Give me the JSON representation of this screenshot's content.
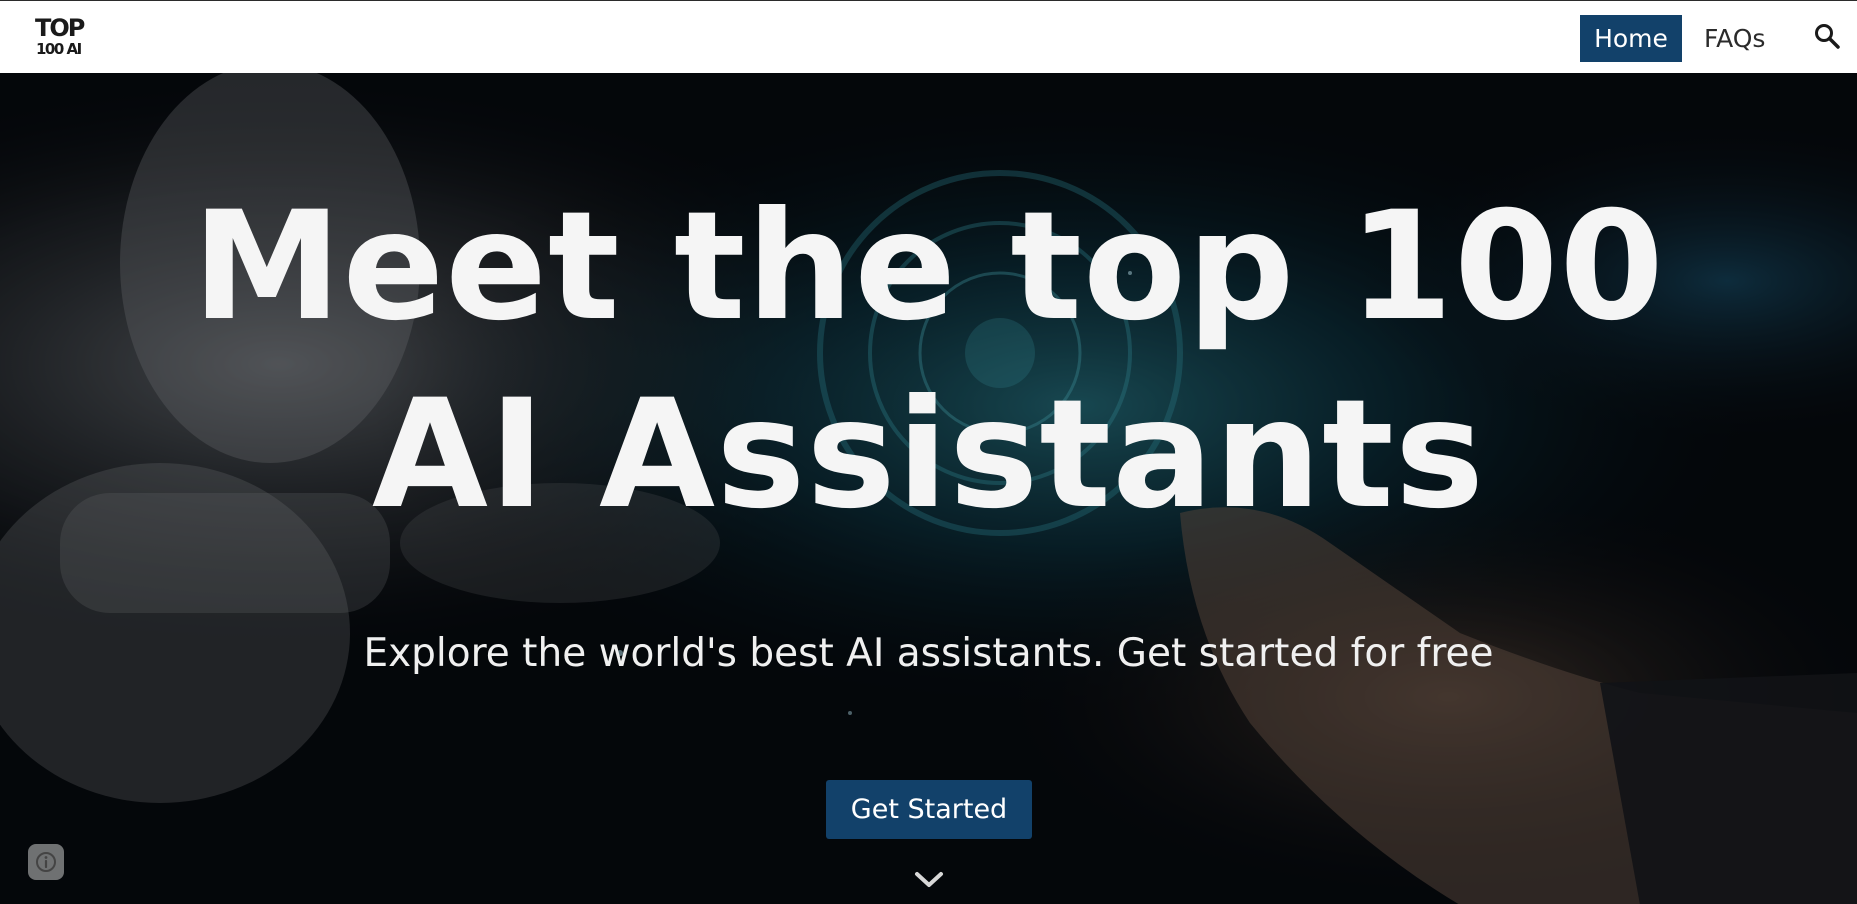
{
  "header": {
    "logo_line1": "TOP",
    "logo_line2": "100 AI",
    "nav": {
      "home_label": "Home",
      "faqs_label": "FAQs"
    },
    "search_icon": "search-icon"
  },
  "hero": {
    "title_line1": "Meet the top 100",
    "title_line2": "AI Assistants",
    "subtitle": "Explore the world's best AI assistants. Get started for free",
    "cta_label": "Get Started",
    "scroll_icon": "chevron-down-icon",
    "info_icon": "info-icon"
  },
  "colors": {
    "accent": "#12416a",
    "hero_text": "#f5f5f5",
    "header_bg": "#ffffff"
  }
}
